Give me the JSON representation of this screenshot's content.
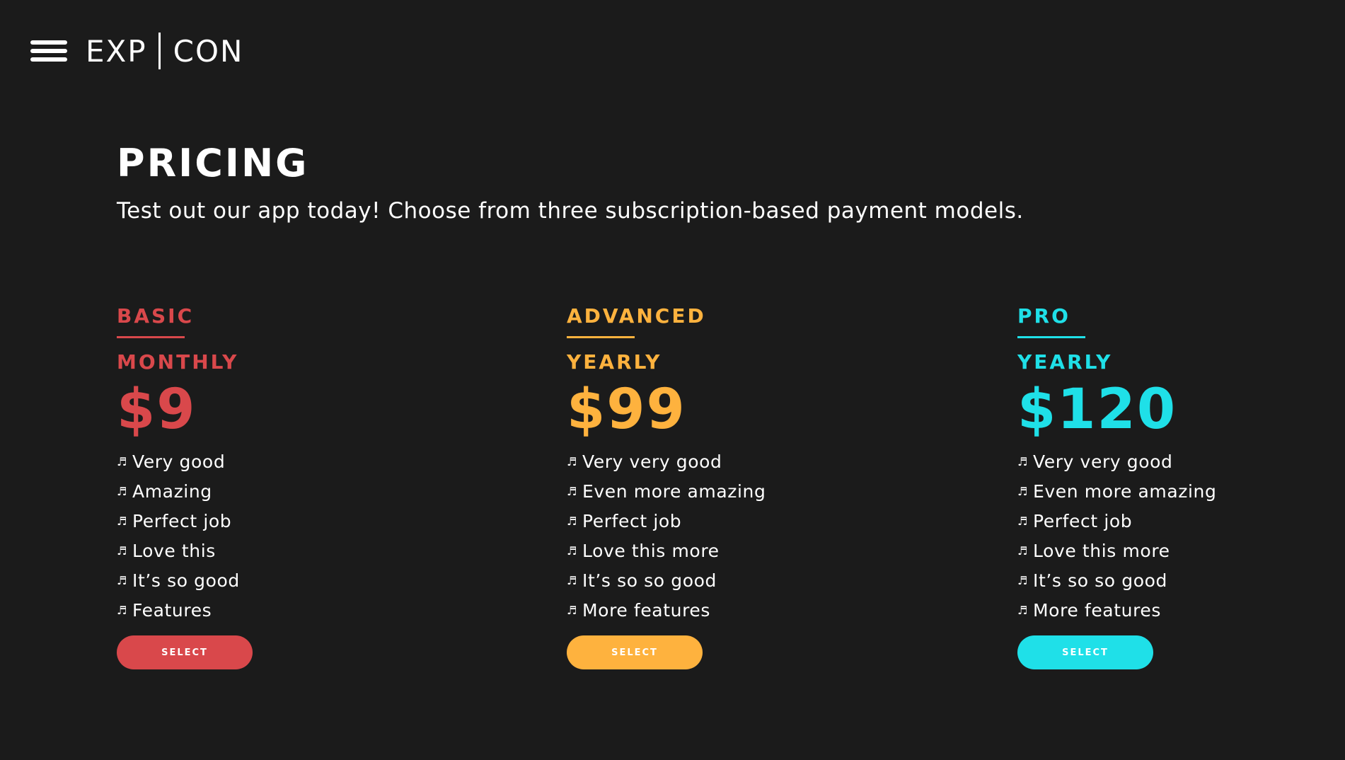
{
  "header": {
    "menu_icon": "hamburger-menu-icon",
    "logo_left": "EXP",
    "logo_right": "CON"
  },
  "hero": {
    "title": "PRICING",
    "subtitle": "Test out our app today! Choose from three subscription-based payment models."
  },
  "colors": {
    "background": "#1b1b1b",
    "basic": "#d9484b",
    "advanced": "#feb23e",
    "pro": "#1fe0e8"
  },
  "plans": [
    {
      "name": "BASIC",
      "period": "MONTHLY",
      "price": "$9",
      "features": [
        "Very good",
        "Amazing",
        "Perfect job",
        "Love this",
        "It’s so good",
        "Features"
      ],
      "button": "SELECT"
    },
    {
      "name": "ADVANCED",
      "period": "YEARLY",
      "price": "$99",
      "features": [
        "Very very good",
        "Even more amazing",
        "Perfect job",
        "Love this more",
        "It’s so so good",
        "More features"
      ],
      "button": "SELECT"
    },
    {
      "name": "PRO",
      "period": "YEARLY",
      "price": "$120",
      "features": [
        "Very very good",
        "Even more amazing",
        "Perfect job",
        "Love this more",
        "It’s so so good",
        "More features"
      ],
      "button": "SELECT"
    }
  ],
  "feature_icon": "music-note-icon"
}
